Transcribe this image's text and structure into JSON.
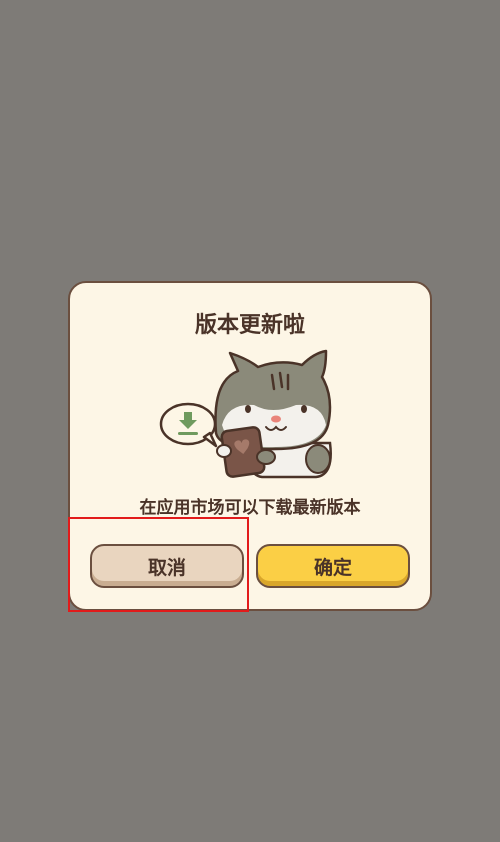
{
  "dialog": {
    "title": "版本更新啦",
    "message": "在应用市场可以下载最新版本",
    "illustration_icon": "cat-with-tablet-download-icon"
  },
  "buttons": {
    "cancel_label": "取消",
    "confirm_label": "确定"
  },
  "colors": {
    "backdrop": "#7e7b77",
    "dialog_bg": "#fdf6e6",
    "border": "#6b4f3f",
    "text": "#4a3328",
    "cancel_bg": "#e9d5bf",
    "confirm_bg": "#fbcf45",
    "highlight": "#e21b1b"
  }
}
